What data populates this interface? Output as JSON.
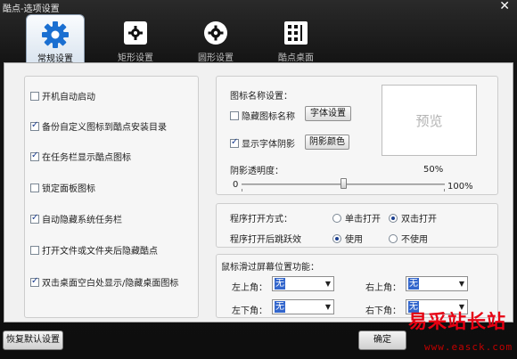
{
  "window": {
    "title": "酷点-选项设置",
    "close_glyph": "✕"
  },
  "tabs": [
    {
      "label": "常规设置",
      "icon": "gear-icon",
      "active": true
    },
    {
      "label": "矩形设置",
      "icon": "square-gear-icon",
      "active": false
    },
    {
      "label": "圆形设置",
      "icon": "circle-gear-icon",
      "active": false
    },
    {
      "label": "酷点桌面",
      "icon": "desktop-grid-icon",
      "active": false
    }
  ],
  "general": {
    "options": [
      {
        "label": "开机自动启动",
        "checked": false
      },
      {
        "label": "备份自定义图标到酷点安装目录",
        "checked": true
      },
      {
        "label": "在任务栏显示酷点图标",
        "checked": true
      },
      {
        "label": "锁定面板图标",
        "checked": false
      },
      {
        "label": "自动隐藏系统任务栏",
        "checked": true
      },
      {
        "label": "打开文件或文件夹后隐藏酷点",
        "checked": false
      },
      {
        "label": "双击桌面空白处显示/隐藏桌面图标",
        "checked": true
      }
    ]
  },
  "icon_name": {
    "heading": "图标名称设置：",
    "hide_label": "隐藏图标名称",
    "hide_checked": false,
    "font_button": "字体设置",
    "shadow_label": "显示字体阴影",
    "shadow_checked": true,
    "shadow_color_button": "阴影颜色",
    "preview": "预览",
    "opacity_label": "阴影透明度：",
    "opacity_value": "50%",
    "opacity_fraction": 0.5,
    "opacity_min": "0",
    "opacity_max": "100%"
  },
  "program": {
    "open_mode_label": "程序打开方式：",
    "single_click": "单击打开",
    "double_click": "双击打开",
    "open_mode_selected": "double",
    "bounce_label": "程序打开后跳跃效",
    "use": "使用",
    "not_use": "不使用",
    "bounce_selected": "use"
  },
  "hot_corners": {
    "heading": "鼠标滑过屏幕位置功能：",
    "top_left_label": "左上角：",
    "top_left_value": "无",
    "top_right_label": "右上角：",
    "top_right_value": "无",
    "bottom_left_label": "左下角：",
    "bottom_left_value": "无",
    "bottom_right_label": "右下角：",
    "bottom_right_value": "无"
  },
  "footer": {
    "restore_button": "恢复默认设置",
    "ok_button": "确定"
  },
  "watermark": {
    "text": "易采站长站",
    "url": "www.easck.com"
  },
  "colors": {
    "accent": "#3366cc",
    "background": "#141414",
    "watermark": "#e60012"
  }
}
